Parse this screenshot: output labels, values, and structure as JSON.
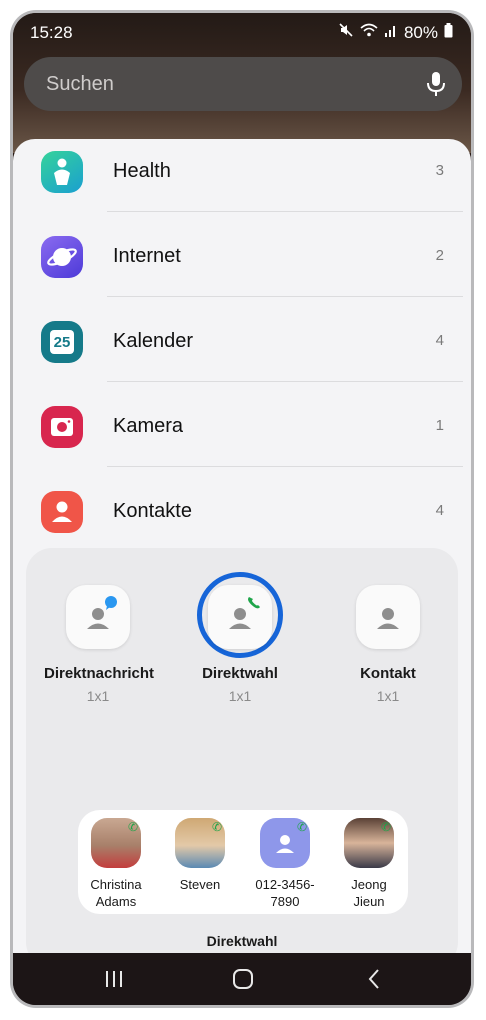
{
  "status_bar": {
    "time": "15:28",
    "battery": "80%"
  },
  "search": {
    "placeholder": "Suchen"
  },
  "apps": [
    {
      "name": "Health",
      "count": "3",
      "icon": "health-icon",
      "color": "#17b4a6"
    },
    {
      "name": "Internet",
      "count": "2",
      "icon": "internet-icon",
      "color": "#6a4fe0"
    },
    {
      "name": "Kalender",
      "count": "4",
      "icon": "calendar-icon",
      "color": "#147a8a",
      "icon_text": "25"
    },
    {
      "name": "Kamera",
      "count": "1",
      "icon": "camera-icon",
      "color": "#d9284f"
    },
    {
      "name": "Kontakte",
      "count": "4",
      "icon": "contacts-icon",
      "color": "#f0564a"
    }
  ],
  "widgets": [
    {
      "name": "Direktnachricht",
      "size": "1x1",
      "icon": "direct-message-icon"
    },
    {
      "name": "Direktwahl",
      "size": "1x1",
      "icon": "direct-dial-icon",
      "highlighted": true
    },
    {
      "name": "Kontakt",
      "size": "1x1",
      "icon": "contact-icon"
    }
  ],
  "preview": {
    "contacts": [
      {
        "name_line1": "Christina",
        "name_line2": "Adams"
      },
      {
        "name_line1": "Steven",
        "name_line2": ""
      },
      {
        "name_line1": "012-3456-",
        "name_line2": "7890"
      },
      {
        "name_line1": "Jeong",
        "name_line2": "Jieun"
      }
    ],
    "label": "Direktwahl"
  },
  "nav": {
    "recents": "recents-icon",
    "home": "home-icon",
    "back": "back-icon"
  },
  "colors": {
    "highlight": "#1665d8",
    "sheet": "#f4f4f6",
    "call_badge": "#1fa54a"
  }
}
